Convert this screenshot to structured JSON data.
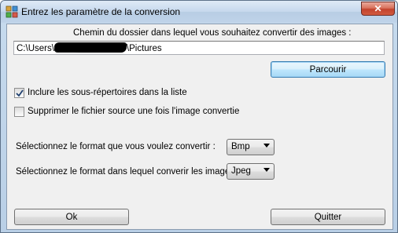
{
  "window": {
    "title": "Entrez les paramètre de la conversion",
    "close_label": "✕"
  },
  "folder": {
    "label": "Chemin du dossier dans lequel vous souhaitez convertir des images :",
    "path_prefix": "C:\\Users\\",
    "path_suffix": "\\Pictures",
    "browse_label": "Parcourir"
  },
  "options": {
    "include_subdirs": {
      "label": "Inclure les sous-répertoires dans la liste",
      "checked": true
    },
    "delete_source": {
      "label": "Supprimer le fichier source une fois l'image convertie",
      "checked": false
    }
  },
  "formats": {
    "source_label": "Sélectionnez le format que vous voulez convertir :",
    "source_value": "Bmp",
    "target_label": "Sélectionnez le format dans lequel converir les images :",
    "target_value": "Jpeg"
  },
  "footer": {
    "ok_label": "Ok",
    "quit_label": "Quitter"
  }
}
